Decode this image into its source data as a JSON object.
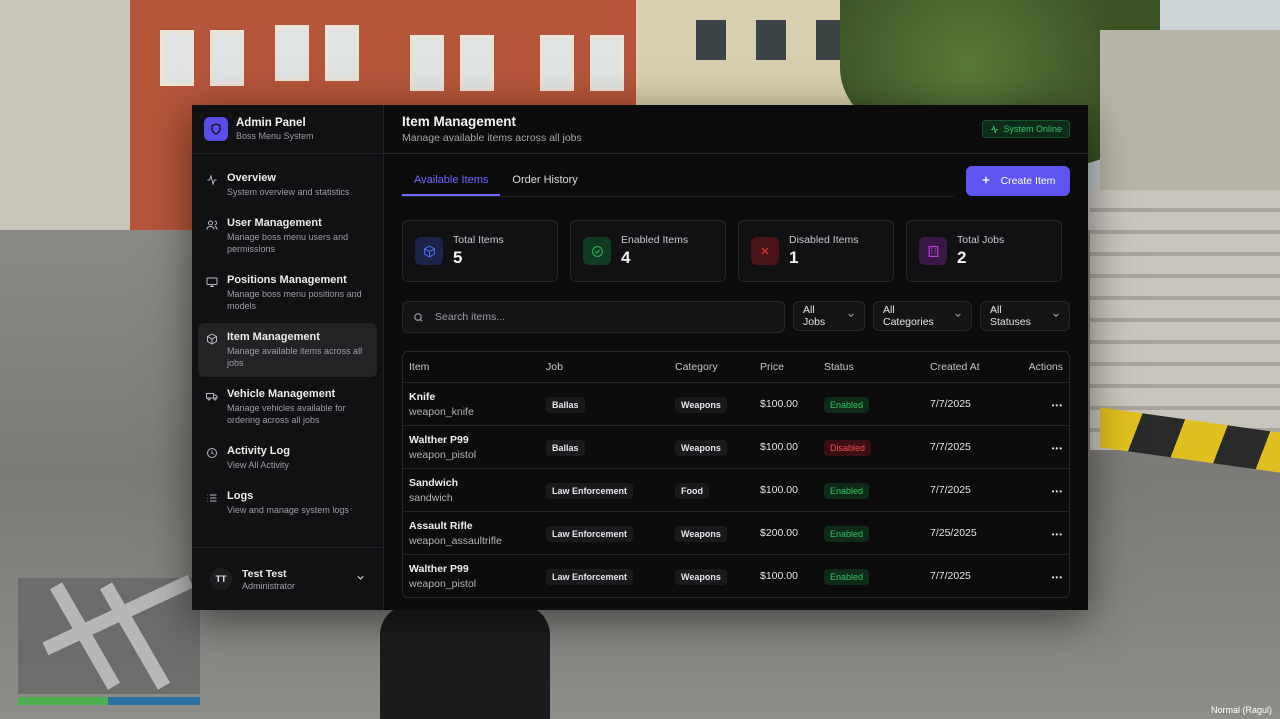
{
  "brand": {
    "title": "Admin Panel",
    "subtitle": "Boss Menu System"
  },
  "nav": [
    {
      "label": "Overview",
      "desc": "System overview and statistics",
      "icon": "activity-icon",
      "active": false
    },
    {
      "label": "User Management",
      "desc": "Manage boss menu users and permissions",
      "icon": "users-icon",
      "active": false
    },
    {
      "label": "Positions Management",
      "desc": "Manage boss menu positions and models",
      "icon": "monitor-icon",
      "active": false
    },
    {
      "label": "Item Management",
      "desc": "Manage available items across all jobs",
      "icon": "box-icon",
      "active": true
    },
    {
      "label": "Vehicle Management",
      "desc": "Manage vehicles available for ordering across all jobs",
      "icon": "truck-icon",
      "active": false
    },
    {
      "label": "Activity Log",
      "desc": "View All Activity",
      "icon": "clock-icon",
      "active": false
    },
    {
      "label": "Logs",
      "desc": "View and manage system logs",
      "icon": "list-icon",
      "active": false
    }
  ],
  "user": {
    "initials": "TT",
    "name": "Test Test",
    "role": "Administrator"
  },
  "header": {
    "title": "Item Management",
    "subtitle": "Manage available items across all jobs",
    "status": "System Online"
  },
  "tabs": [
    {
      "label": "Available Items",
      "active": true
    },
    {
      "label": "Order History",
      "active": false
    }
  ],
  "create_button": "Create Item",
  "stats": [
    {
      "label": "Total Items",
      "value": "5",
      "icon": "cube-icon",
      "color": "#3b5bdb"
    },
    {
      "label": "Enabled Items",
      "value": "4",
      "icon": "check-circle-icon",
      "color": "#2fb35a"
    },
    {
      "label": "Disabled Items",
      "value": "1",
      "icon": "x-icon",
      "color": "#e03131"
    },
    {
      "label": "Total Jobs",
      "value": "2",
      "icon": "building-icon",
      "color": "#9c36b5"
    }
  ],
  "search": {
    "placeholder": "Search items..."
  },
  "filters": [
    "All Jobs",
    "All Categories",
    "All Statuses"
  ],
  "table": {
    "columns": [
      "Item",
      "Job",
      "Category",
      "Price",
      "Status",
      "Created At",
      "Actions"
    ],
    "rows": [
      {
        "name": "Knife",
        "id": "weapon_knife",
        "job": "Ballas",
        "category": "Weapons",
        "price": "$100.00",
        "status": "Enabled",
        "created": "7/7/2025"
      },
      {
        "name": "Walther P99",
        "id": "weapon_pistol",
        "job": "Ballas",
        "category": "Weapons",
        "price": "$100.00",
        "status": "Disabled",
        "created": "7/7/2025"
      },
      {
        "name": "Sandwich",
        "id": "sandwich",
        "job": "Law Enforcement",
        "category": "Food",
        "price": "$100.00",
        "status": "Enabled",
        "created": "7/7/2025"
      },
      {
        "name": "Assault Rifle",
        "id": "weapon_assaultrifle",
        "job": "Law Enforcement",
        "category": "Weapons",
        "price": "$200.00",
        "status": "Enabled",
        "created": "7/25/2025"
      },
      {
        "name": "Walther P99",
        "id": "weapon_pistol",
        "job": "Law Enforcement",
        "category": "Weapons",
        "price": "$100.00",
        "status": "Enabled",
        "created": "7/7/2025"
      }
    ]
  },
  "game_hud": {
    "watermark": "Normal (Ragul)"
  }
}
